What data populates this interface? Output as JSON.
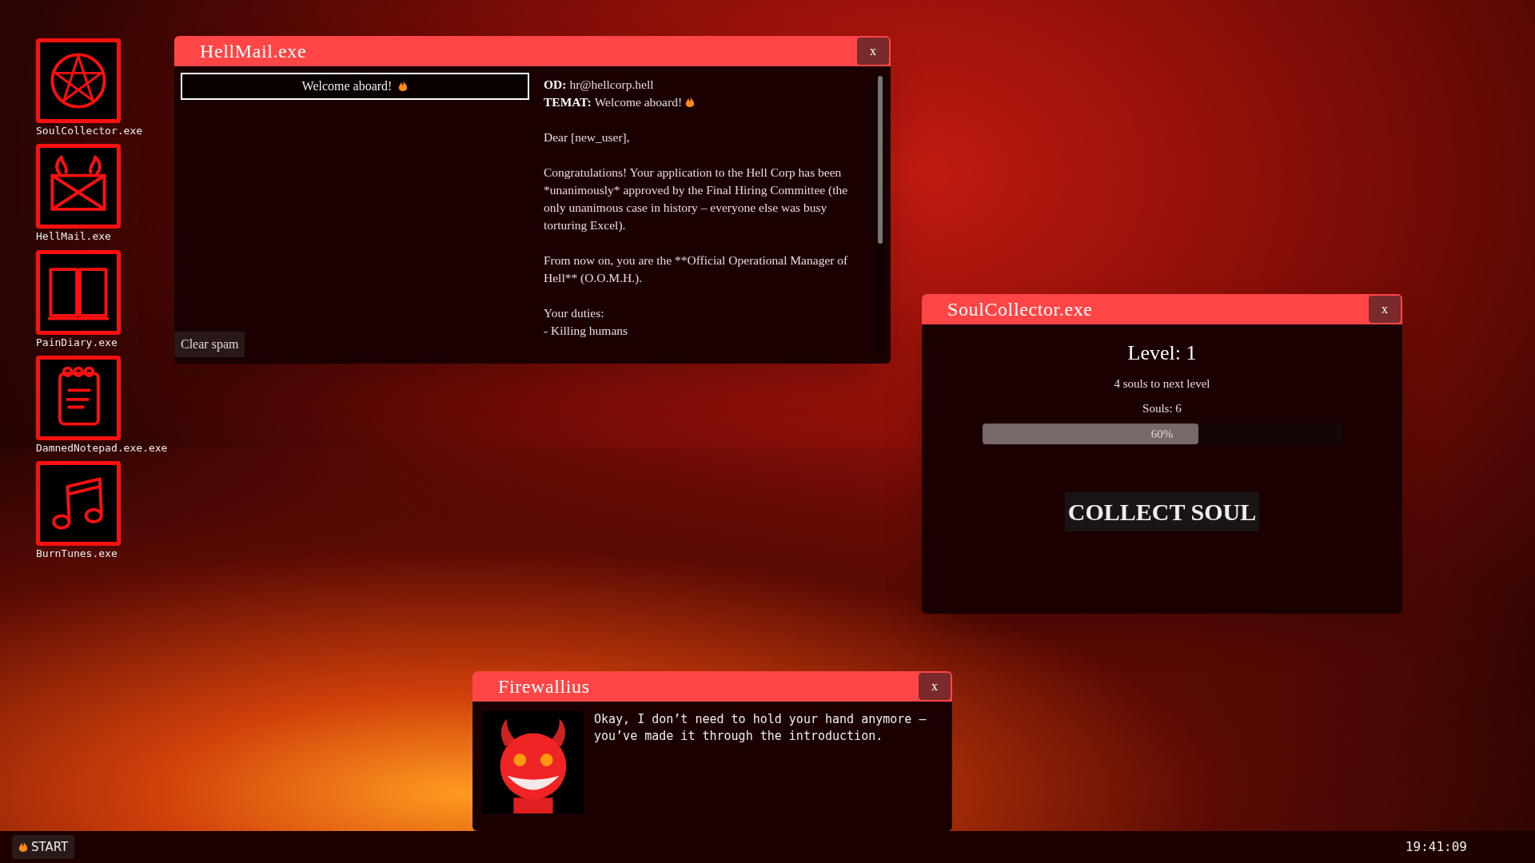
{
  "desktop_icons": [
    {
      "label": "SoulCollector.exe",
      "kind": "pentagram"
    },
    {
      "label": "HellMail.exe",
      "kind": "mail"
    },
    {
      "label": "PainDiary.exe",
      "kind": "book"
    },
    {
      "label": "DamnedNotepad.exe.exe",
      "kind": "notepad"
    },
    {
      "label": "BurnTunes.exe",
      "kind": "music"
    }
  ],
  "hellmail": {
    "title": "HellMail.exe",
    "close": "x",
    "messages": [
      {
        "subject": "Welcome aboard!",
        "selected": true
      }
    ],
    "clear_button": "Clear spam",
    "email": {
      "from_label": "OD:",
      "from": "hr@hellcorp.hell",
      "subject_label": "TEMAT:",
      "subject": "Welcome aboard!",
      "paragraphs": [
        [
          "Dear [new_user],"
        ],
        [
          "Congratulations! Your application to the Hell Corp has been *unanimously* approved by the Final Hiring Committee (the only unanimous case in history – everyone else was busy torturing Excel)."
        ],
        [
          "From now on, you are the **Official Operational Manager of Hell** (O.O.M.H.)."
        ],
        [
          "Your duties:",
          "- Killing humans"
        ]
      ]
    }
  },
  "soulcollector": {
    "title": "SoulCollector.exe",
    "close": "x",
    "level_text": "Level: 1",
    "next_level": "4 souls to next level",
    "souls": "Souls: 6",
    "progress": {
      "level": 0.6,
      "label": "60%"
    },
    "collect_button": "COLLECT SOUL"
  },
  "firewallius": {
    "title": "Firewallius",
    "close": "x",
    "message": "Okay, I don’t need to hold your hand anymore – you’ve made it through the introduction."
  },
  "taskbar": {
    "start": "START",
    "clock": "19:41:09"
  }
}
